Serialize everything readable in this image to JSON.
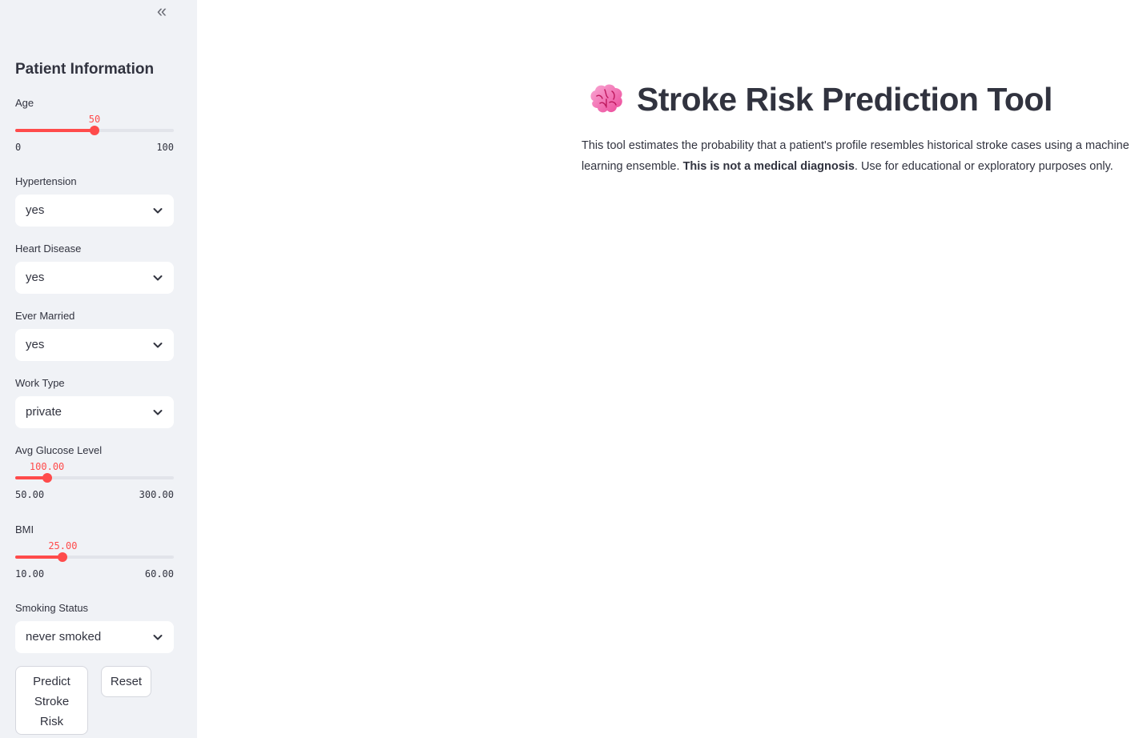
{
  "sidebar": {
    "title": "Patient Information",
    "age": {
      "label": "Age",
      "value": "50",
      "min": "0",
      "max": "100",
      "fraction": 0.5
    },
    "hypertension": {
      "label": "Hypertension",
      "selected": "yes"
    },
    "heart_disease": {
      "label": "Heart Disease",
      "selected": "yes"
    },
    "ever_married": {
      "label": "Ever Married",
      "selected": "yes"
    },
    "work_type": {
      "label": "Work Type",
      "selected": "private"
    },
    "glucose": {
      "label": "Avg Glucose Level",
      "value": "100.00",
      "min": "50.00",
      "max": "300.00",
      "fraction": 0.2
    },
    "bmi": {
      "label": "BMI",
      "value": "25.00",
      "min": "10.00",
      "max": "60.00",
      "fraction": 0.3
    },
    "smoking": {
      "label": "Smoking Status",
      "selected": "never smoked"
    },
    "predict_label": "Predict Stroke Risk",
    "reset_label": "Reset"
  },
  "main": {
    "title": "Stroke Risk Prediction Tool",
    "desc_before": "This tool estimates the probability that a patient's profile resembles historical stroke cases using a machine learning ensemble. ",
    "desc_bold": "This is not a medical diagnosis",
    "desc_after": ". Use for educational or exploratory purposes only."
  },
  "colors": {
    "accent": "#ff4b4b",
    "sidebar_bg": "#f0f2f6",
    "text": "#31333f"
  },
  "icons": {
    "collapse": "double-chevron-left-icon",
    "title": "brain-icon",
    "select": "chevron-down-icon"
  }
}
